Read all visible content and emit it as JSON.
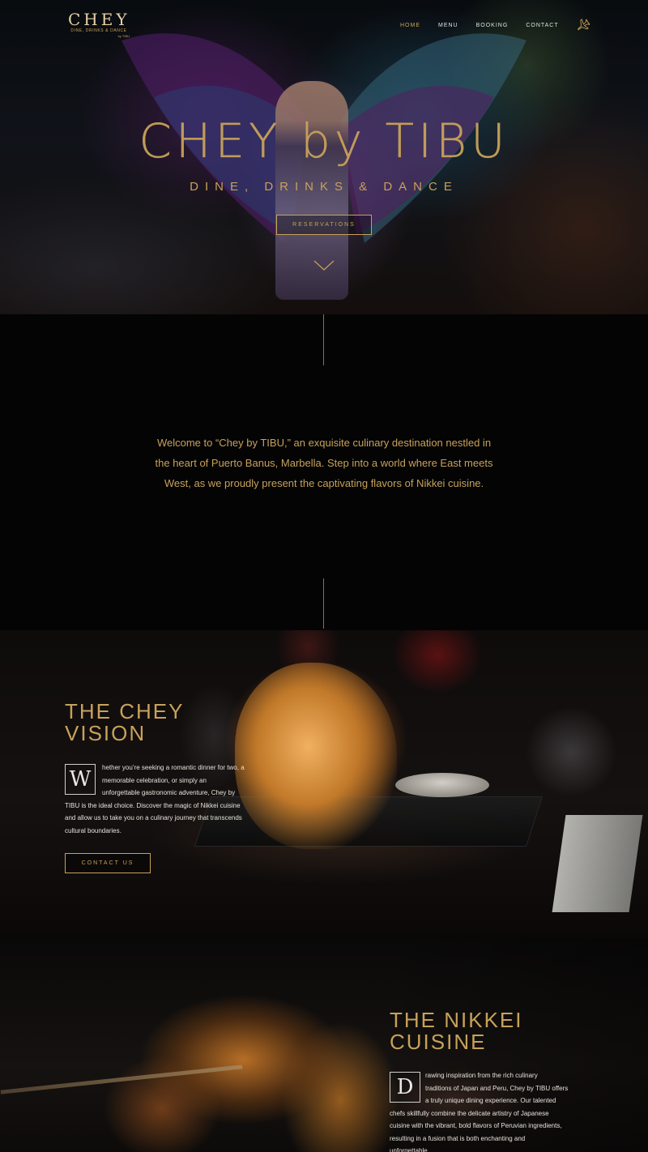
{
  "brand": {
    "logo_text": "CHEY",
    "logo_subtitle": "DINE, DRINKS & DANCE",
    "logo_by": "by TIBU",
    "accent_color": "#c8a15a"
  },
  "nav": {
    "items": [
      {
        "label": "HOME",
        "active": true
      },
      {
        "label": "MENU",
        "active": false
      },
      {
        "label": "BOOKING",
        "active": false
      },
      {
        "label": "CONTACT",
        "active": false
      }
    ],
    "language_icon": "airplane-icon"
  },
  "hero": {
    "title": "CHEY by TIBU",
    "tagline": "DINE, DRINKS & DANCE",
    "cta_label": "RESERVATIONS",
    "scroll_icon": "chevron-down-icon"
  },
  "intro": {
    "text": "Welcome to “Chey by TIBU,” an exquisite culinary destination nestled in the heart of Puerto Banus, Marbella. Step into a world where East meets West, as we proudly present the captivating flavors of Nikkei cuisine."
  },
  "vision": {
    "title_line1": "THE CHEY",
    "title_line2": "VISION",
    "dropcap": "W",
    "body_lines": [
      "hether you’re seeking a romantic dinner for two, a",
      "memorable celebration, or simply an",
      "unforgettable gastronomic adventure, Chey by",
      "TIBU is the ideal choice. Discover the magic of Nikkei cuisine",
      "and allow us to take you on a culinary journey that transcends",
      "cultural boundaries."
    ],
    "cta_label": "CONTACT US"
  },
  "nikkei": {
    "title_line1": "THE NIKKEI",
    "title_line2": "CUISINE",
    "dropcap": "D",
    "body_lines": [
      "rawing inspiration from the rich culinary",
      "traditions of Japan and Peru, Chey by TIBU offers",
      "a truly unique dining experience. Our talented",
      "chefs skillfully combine the delicate artistry of Japanese",
      "cuisine with the vibrant, bold flavors of Peruvian ingredients,",
      "resulting in a fusion that is both enchanting and",
      "unforgettable."
    ]
  }
}
